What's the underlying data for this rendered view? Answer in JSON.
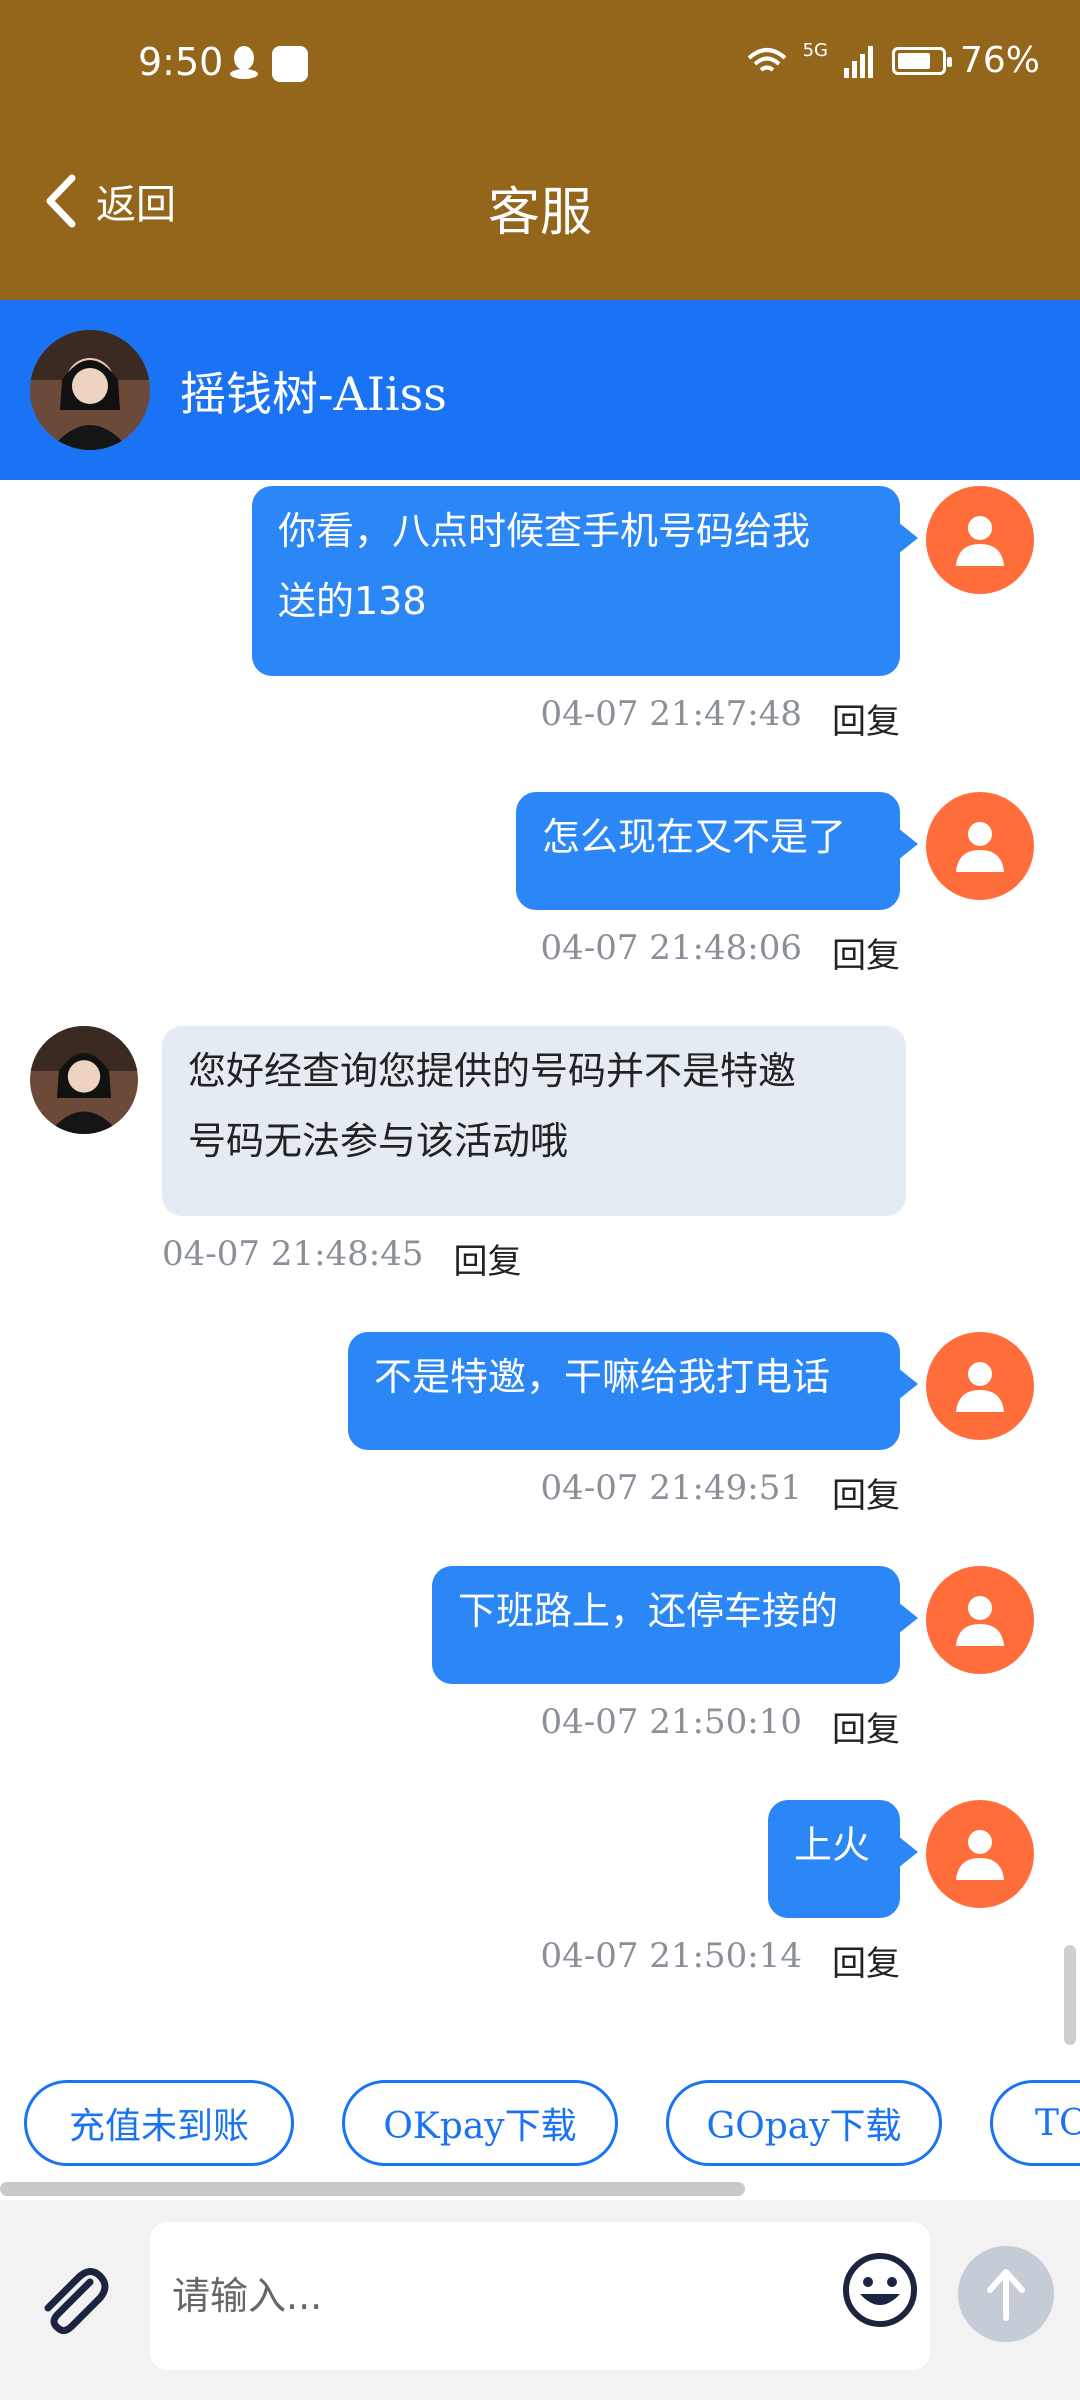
{
  "status": {
    "time": "9:50",
    "network": "5G",
    "battery_text": "76%",
    "battery_level": 0.76
  },
  "nav": {
    "back_label": "返回",
    "title": "客服"
  },
  "agent": {
    "name": "摇钱树-AIiss"
  },
  "messages": [
    {
      "dir": "out",
      "text_line1": "你看，八点时候查手机号码给我",
      "text_line2": "送的138",
      "time": "04-07 21:47:48",
      "reply": "回复"
    },
    {
      "dir": "out",
      "text": "怎么现在又不是了",
      "time": "04-07 21:48:06",
      "reply": "回复"
    },
    {
      "dir": "in",
      "text_line1": "您好经查询您提供的号码并不是特邀",
      "text_line2": "号码无法参与该活动哦",
      "time": "04-07 21:48:45",
      "reply": "回复"
    },
    {
      "dir": "out",
      "text": "不是特邀，干嘛给我打电话",
      "time": "04-07 21:49:51",
      "reply": "回复"
    },
    {
      "dir": "out",
      "text": "下班路上，还停车接的",
      "time": "04-07 21:50:10",
      "reply": "回复"
    },
    {
      "dir": "out",
      "text": "上火",
      "time": "04-07 21:50:14",
      "reply": "回复"
    }
  ],
  "quick_replies": [
    "充值未到账",
    "OKpay下载",
    "GOpay下载",
    "TO"
  ],
  "input": {
    "placeholder": "请输入..."
  },
  "colors": {
    "brand_bar": "#94661c",
    "agent_bar": "#1a73f5",
    "outgoing_bubble": "#2b86f6",
    "incoming_bubble": "#e4ebf3",
    "user_avatar": "#ff6e3a"
  }
}
